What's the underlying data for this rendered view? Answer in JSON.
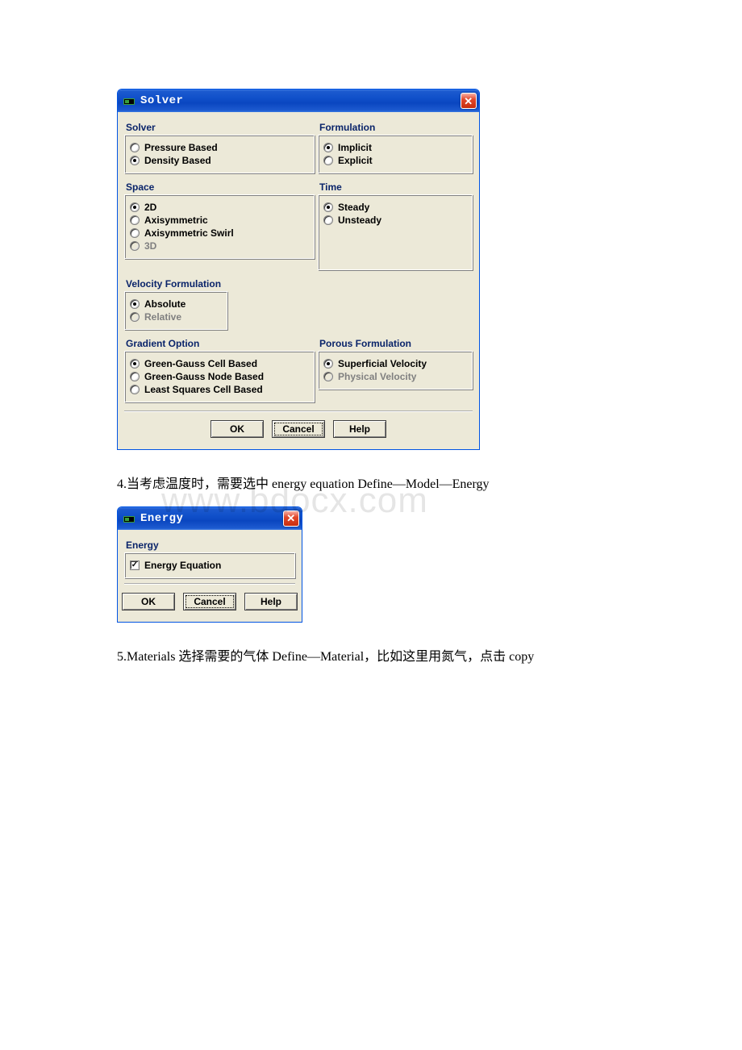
{
  "solver": {
    "title": "Solver",
    "groups": {
      "solver": {
        "label": "Solver",
        "options": {
          "pressure": {
            "label": "Pressure Based",
            "selected": false,
            "enabled": true
          },
          "density": {
            "label": "Density Based",
            "selected": true,
            "enabled": true
          }
        }
      },
      "formulation": {
        "label": "Formulation",
        "options": {
          "implicit": {
            "label": "Implicit",
            "selected": true,
            "enabled": true
          },
          "explicit": {
            "label": "Explicit",
            "selected": false,
            "enabled": true
          }
        }
      },
      "space": {
        "label": "Space",
        "options": {
          "two_d": {
            "label": "2D",
            "selected": true,
            "enabled": true
          },
          "axi": {
            "label": "Axisymmetric",
            "selected": false,
            "enabled": true
          },
          "axi_sw": {
            "label": "Axisymmetric Swirl",
            "selected": false,
            "enabled": true
          },
          "three_d": {
            "label": "3D",
            "selected": false,
            "enabled": false
          }
        }
      },
      "time": {
        "label": "Time",
        "options": {
          "steady": {
            "label": "Steady",
            "selected": true,
            "enabled": true
          },
          "unsteady": {
            "label": "Unsteady",
            "selected": false,
            "enabled": true
          }
        }
      },
      "velocity": {
        "label": "Velocity Formulation",
        "options": {
          "absolute": {
            "label": "Absolute",
            "selected": true,
            "enabled": true
          },
          "relative": {
            "label": "Relative",
            "selected": false,
            "enabled": false
          }
        }
      },
      "gradient": {
        "label": "Gradient Option",
        "options": {
          "gg_cell": {
            "label": "Green-Gauss Cell Based",
            "selected": true,
            "enabled": true
          },
          "gg_node": {
            "label": "Green-Gauss Node Based",
            "selected": false,
            "enabled": true
          },
          "lsq_cell": {
            "label": "Least Squares Cell Based",
            "selected": false,
            "enabled": true
          }
        }
      },
      "porous": {
        "label": "Porous Formulation",
        "options": {
          "superficial": {
            "label": "Superficial Velocity",
            "selected": true,
            "enabled": true
          },
          "physical": {
            "label": "Physical Velocity",
            "selected": false,
            "enabled": false
          }
        }
      }
    },
    "buttons": {
      "ok": "OK",
      "cancel": "Cancel",
      "help": "Help"
    }
  },
  "text_4": "4.当考虑温度时，需要选中 energy equation Define—Model—Energy",
  "energy": {
    "title": "Energy",
    "group_label": "Energy",
    "checkbox": {
      "label": "Energy Equation",
      "checked": true
    },
    "buttons": {
      "ok": "OK",
      "cancel": "Cancel",
      "help": "Help"
    }
  },
  "text_5": "5.Materials 选择需要的气体 Define—Material，比如这里用氮气，点击 copy",
  "watermark": "www.bdocx.com"
}
